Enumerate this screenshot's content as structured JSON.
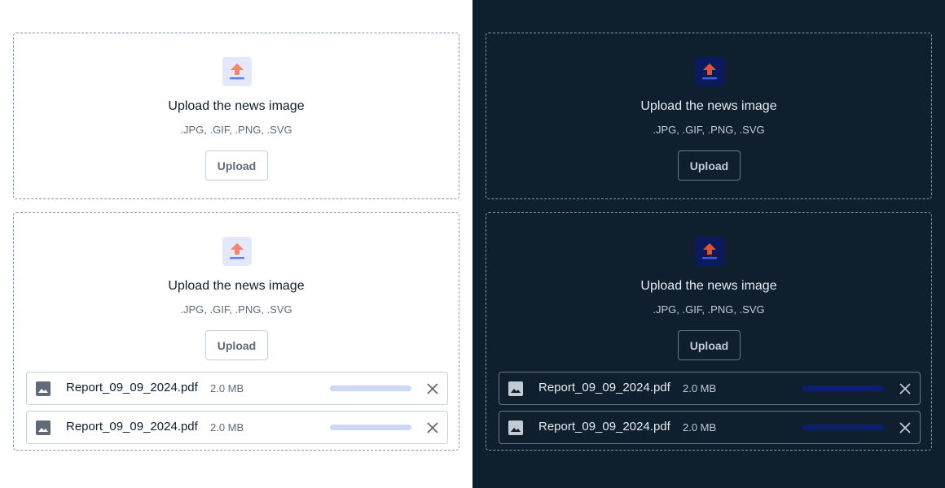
{
  "colors": {
    "light_bg": "#ffffff",
    "dark_bg": "#0f1f2e",
    "accent_orange": "#f5866a",
    "accent_orange_dark": "#e0532b",
    "accent_blue": "#5a86f0",
    "progress_light": "#ccd8f5",
    "progress_dark": "#0a1f6e"
  },
  "light": {
    "dropzone_1": {
      "icon": "upload-arrow-icon",
      "title": "Upload the news image",
      "types": ".JPG, .GIF, .PNG, .SVG",
      "button": "Upload"
    },
    "dropzone_2": {
      "icon": "upload-arrow-icon",
      "title": "Upload the news image",
      "types": ".JPG, .GIF, .PNG, .SVG",
      "button": "Upload",
      "files": [
        {
          "name": "Report_09_09_2024.pdf",
          "size": "2.0 MB",
          "icon": "image-file-icon",
          "progress": 1.0
        },
        {
          "name": "Report_09_09_2024.pdf",
          "size": "2.0 MB",
          "icon": "image-file-icon",
          "progress": 1.0
        }
      ]
    }
  },
  "dark": {
    "dropzone_1": {
      "icon": "upload-arrow-icon",
      "title": "Upload the news image",
      "types": ".JPG, .GIF, .PNG, .SVG",
      "button": "Upload"
    },
    "dropzone_2": {
      "icon": "upload-arrow-icon",
      "title": "Upload the news image",
      "types": ".JPG, .GIF, .PNG, .SVG",
      "button": "Upload",
      "files": [
        {
          "name": "Report_09_09_2024.pdf",
          "size": "2.0 MB",
          "icon": "image-file-icon",
          "progress": 1.0
        },
        {
          "name": "Report_09_09_2024.pdf",
          "size": "2.0 MB",
          "icon": "image-file-icon",
          "progress": 1.0
        }
      ]
    }
  }
}
